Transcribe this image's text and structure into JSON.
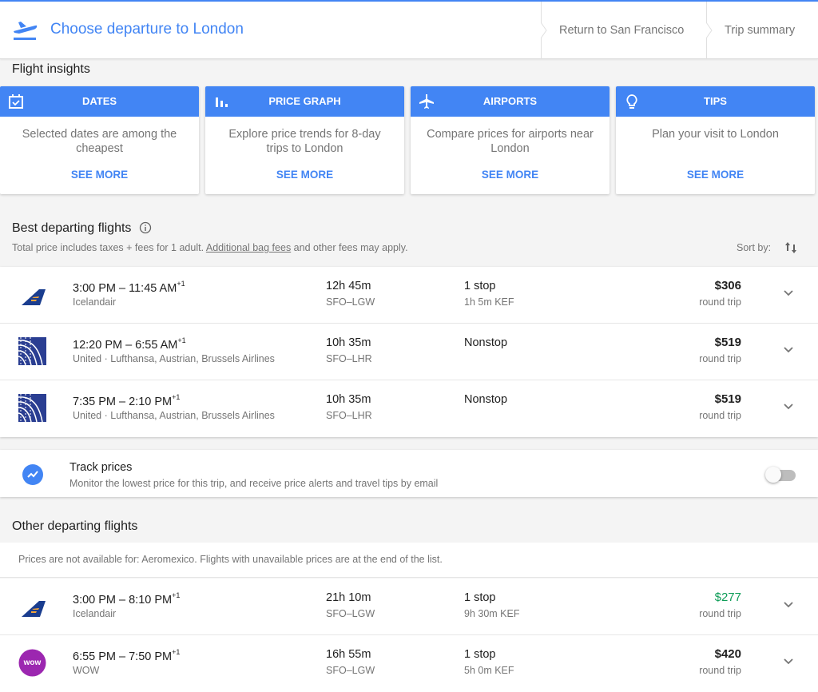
{
  "header": {
    "title": "Choose departure to London",
    "steps": [
      "Return to San Francisco",
      "Trip summary"
    ]
  },
  "insights": {
    "title": "Flight insights",
    "cards": [
      {
        "icon": "calendar-check-icon",
        "label": "DATES",
        "text": "Selected dates are among the cheapest",
        "link": "SEE MORE"
      },
      {
        "icon": "bar-chart-icon",
        "label": "PRICE GRAPH",
        "text": "Explore price trends for 8-day trips to London",
        "link": "SEE MORE"
      },
      {
        "icon": "airplane-icon",
        "label": "AIRPORTS",
        "text": "Compare prices for airports near London",
        "link": "SEE MORE"
      },
      {
        "icon": "lightbulb-icon",
        "label": "TIPS",
        "text": "Plan your visit to London",
        "link": "SEE MORE"
      }
    ]
  },
  "best": {
    "title": "Best departing flights",
    "note_prefix": "Total price includes taxes + fees for 1 adult. ",
    "note_link": "Additional bag fees",
    "note_suffix": " and other fees may apply.",
    "sort_label": "Sort by:",
    "flights": [
      {
        "logo": "icelandair",
        "times": "3:00 PM – 11:45 AM",
        "day_offset": "+1",
        "airline": "Icelandair",
        "duration": "12h 45m",
        "route": "SFO–LGW",
        "stops": "1 stop",
        "layover": "1h 5m KEF",
        "price": "$306",
        "price_note": "round trip"
      },
      {
        "logo": "united",
        "times": "12:20 PM – 6:55 AM",
        "day_offset": "+1",
        "airline": "United · Lufthansa, Austrian, Brussels Airlines",
        "duration": "10h 35m",
        "route": "SFO–LHR",
        "stops": "Nonstop",
        "layover": "",
        "price": "$519",
        "price_note": "round trip"
      },
      {
        "logo": "united",
        "times": "7:35 PM – 2:10 PM",
        "day_offset": "+1",
        "airline": "United · Lufthansa, Austrian, Brussels Airlines",
        "duration": "10h 35m",
        "route": "SFO–LHR",
        "stops": "Nonstop",
        "layover": "",
        "price": "$519",
        "price_note": "round trip"
      }
    ]
  },
  "track": {
    "title": "Track prices",
    "subtitle": "Monitor the lowest price for this trip, and receive price alerts and travel tips by email",
    "enabled": false
  },
  "other": {
    "title": "Other departing flights",
    "notice": "Prices are not available for: Aeromexico. Flights with unavailable prices are at the end of the list.",
    "flights": [
      {
        "logo": "icelandair",
        "times": "3:00 PM – 8:10 PM",
        "day_offset": "+1",
        "airline": "Icelandair",
        "duration": "21h 10m",
        "route": "SFO–LGW",
        "stops": "1 stop",
        "layover": "9h 30m KEF",
        "price": "$277",
        "price_note": "round trip",
        "cheapest": true
      },
      {
        "logo": "wow",
        "times": "6:55 PM – 7:50 PM",
        "day_offset": "+1",
        "airline": "WOW",
        "duration": "16h 55m",
        "route": "SFO–LGW",
        "stops": "1 stop",
        "layover": "5h 0m KEF",
        "price": "$420",
        "price_note": "round trip",
        "cheapest": false
      }
    ]
  },
  "colors": {
    "accent": "#4285f4",
    "cheapest_price": "#0f9d58",
    "wow_brand": "#9c27b0",
    "icelandair_blue": "#1a3d8f",
    "united_blue": "#2a3e92"
  }
}
